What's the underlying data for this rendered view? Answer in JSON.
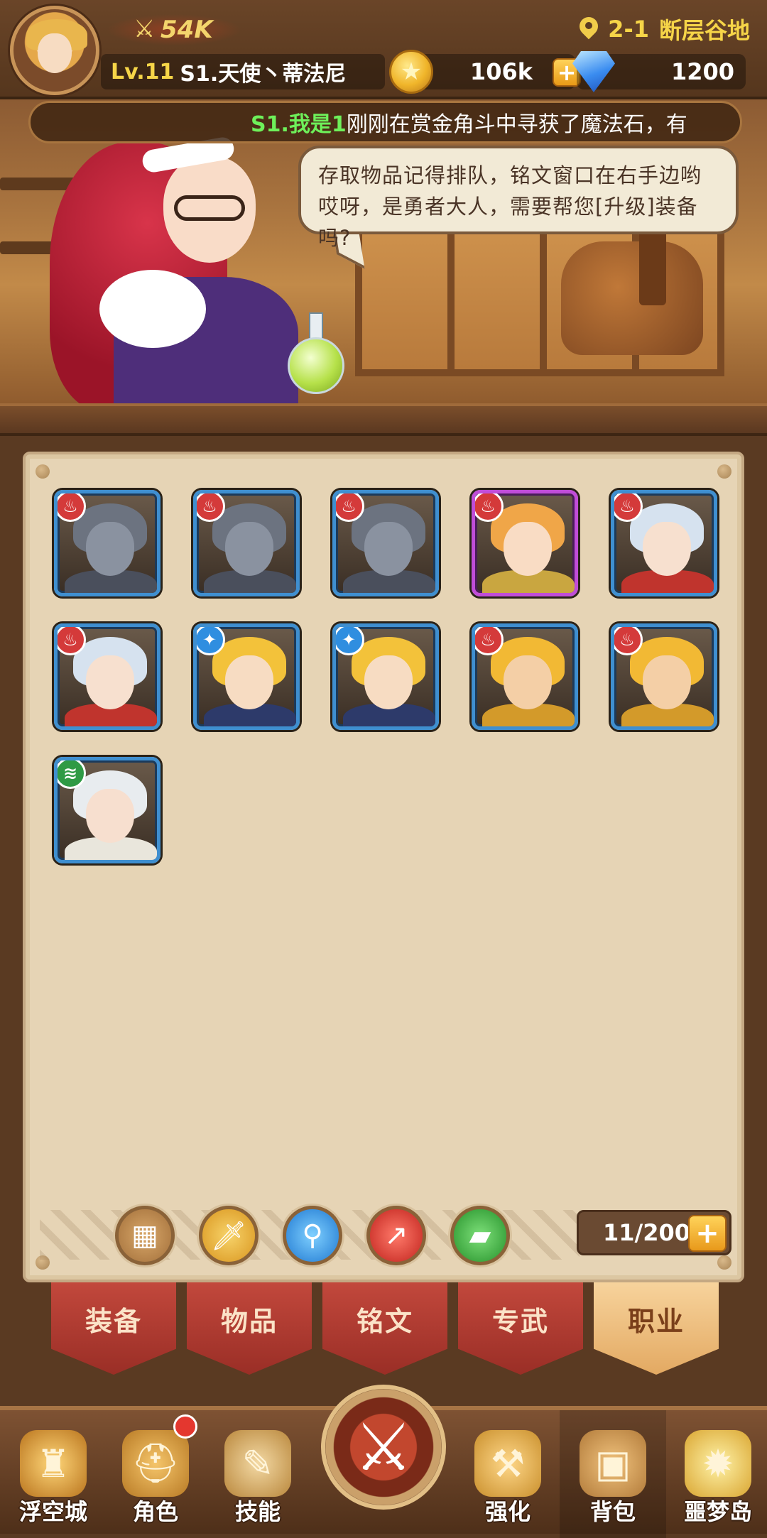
{
  "player": {
    "power": "54K",
    "level": "Lv.11",
    "name": "S1.天使丶蒂法尼",
    "location_stage": "2-1",
    "location_name": "断层谷地"
  },
  "currency": {
    "gold": "106k",
    "gems": "1200"
  },
  "ticker": {
    "sender": "S1.我是1",
    "message": "刚刚在赏金角斗中寻获了魔法石，有"
  },
  "dialogue": {
    "text": "存取物品记得排队，铭文窗口在右手边哟哎呀，是勇者大人，需要帮您[升级]装备吗?"
  },
  "inventory": {
    "items": [
      {
        "name": "werewolf",
        "element": "fire",
        "rarity": "blue",
        "hair": "#6c7380",
        "face": "#8a92a0",
        "body": "#4a4f5c"
      },
      {
        "name": "werewolf",
        "element": "fire",
        "rarity": "blue",
        "hair": "#6c7380",
        "face": "#8a92a0",
        "body": "#4a4f5c"
      },
      {
        "name": "werewolf",
        "element": "fire",
        "rarity": "blue",
        "hair": "#6c7380",
        "face": "#8a92a0",
        "body": "#4a4f5c"
      },
      {
        "name": "armored-girl",
        "element": "fire",
        "rarity": "purple",
        "hair": "#f0a648",
        "face": "#f9dcc4",
        "body": "#c9a640"
      },
      {
        "name": "silver-priestess",
        "element": "fire",
        "rarity": "blue",
        "hair": "#d6e2ef",
        "face": "#f7e0cf",
        "body": "#c0342d"
      },
      {
        "name": "silver-priestess",
        "element": "fire",
        "rarity": "blue",
        "hair": "#d6e2ef",
        "face": "#f7e0cf",
        "body": "#c0342d"
      },
      {
        "name": "blond-warrior",
        "element": "light",
        "rarity": "blue",
        "hair": "#f3c23a",
        "face": "#f7dcc2",
        "body": "#2d3a6a"
      },
      {
        "name": "blond-warrior",
        "element": "light",
        "rarity": "blue",
        "hair": "#f3c23a",
        "face": "#f7dcc2",
        "body": "#2d3a6a"
      },
      {
        "name": "golden-knight",
        "element": "fire",
        "rarity": "blue",
        "hair": "#f2b934",
        "face": "#f4cfa6",
        "body": "#d39a2a"
      },
      {
        "name": "golden-knight",
        "element": "fire",
        "rarity": "blue",
        "hair": "#f2b934",
        "face": "#f4cfa6",
        "body": "#d39a2a"
      },
      {
        "name": "white-hair-mage",
        "element": "wind",
        "rarity": "blue",
        "hair": "#e8ecef",
        "face": "#f7dfcf",
        "body": "#e9e6dc"
      }
    ],
    "capacity": "11/200"
  },
  "filters": [
    "all",
    "weapon",
    "staff",
    "spear",
    "gun"
  ],
  "tabs": [
    {
      "label": "装备",
      "active": false
    },
    {
      "label": "物品",
      "active": false
    },
    {
      "label": "铭文",
      "active": false
    },
    {
      "label": "专武",
      "active": false
    },
    {
      "label": "职业",
      "active": true
    }
  ],
  "nav": [
    {
      "label": "浮空城",
      "icon": "castle-icon"
    },
    {
      "label": "角色",
      "icon": "helmet-icon",
      "badge": true
    },
    {
      "label": "技能",
      "icon": "skill-book-icon"
    },
    {
      "label": "",
      "icon": "crossed-swords-icon"
    },
    {
      "label": "强化",
      "icon": "anvil-icon"
    },
    {
      "label": "背包",
      "icon": "backpack-icon",
      "active": true
    },
    {
      "label": "噩梦岛",
      "icon": "nightmare-island-icon"
    }
  ],
  "colors": {
    "fire": "#d43a3a",
    "light": "#2f8ee0",
    "wind": "#2f9a45",
    "rarity_blue": "#3f8fd0",
    "rarity_purple": "#c04dd8",
    "accent_gold": "#f6d548"
  }
}
